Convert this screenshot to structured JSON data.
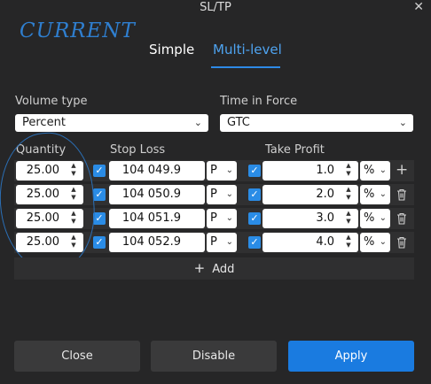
{
  "window": {
    "title": "SL/TP",
    "close_glyph": "✕"
  },
  "annotation": {
    "text": "CURRENT"
  },
  "tabs": [
    {
      "label": "Simple",
      "active": false
    },
    {
      "label": "Multi-level",
      "active": true
    }
  ],
  "volume_type": {
    "label": "Volume type",
    "value": "Percent"
  },
  "time_in_force": {
    "label": "Time in Force",
    "value": "GTC"
  },
  "columns": {
    "quantity": "Quantity",
    "stop_loss": "Stop Loss",
    "take_profit": "Take Profit"
  },
  "rows": [
    {
      "quantity": "25.00",
      "stop_loss": "104 049.9",
      "sl_unit": "P",
      "take_profit": "1.0",
      "tp_unit": "%",
      "action": "plus-icon"
    },
    {
      "quantity": "25.00",
      "stop_loss": "104 050.9",
      "sl_unit": "P",
      "take_profit": "2.0",
      "tp_unit": "%",
      "action": "trash-icon"
    },
    {
      "quantity": "25.00",
      "stop_loss": "104 051.9",
      "sl_unit": "P",
      "take_profit": "3.0",
      "tp_unit": "%",
      "action": "trash-icon"
    },
    {
      "quantity": "25.00",
      "stop_loss": "104 052.9",
      "sl_unit": "P",
      "take_profit": "4.0",
      "tp_unit": "%",
      "action": "trash-icon"
    }
  ],
  "add_button": {
    "label": "Add"
  },
  "buttons": {
    "close": "Close",
    "disable": "Disable",
    "apply": "Apply"
  },
  "colors": {
    "accent": "#1a7be0",
    "background": "#262627",
    "annotation": "#2f7fd0"
  }
}
